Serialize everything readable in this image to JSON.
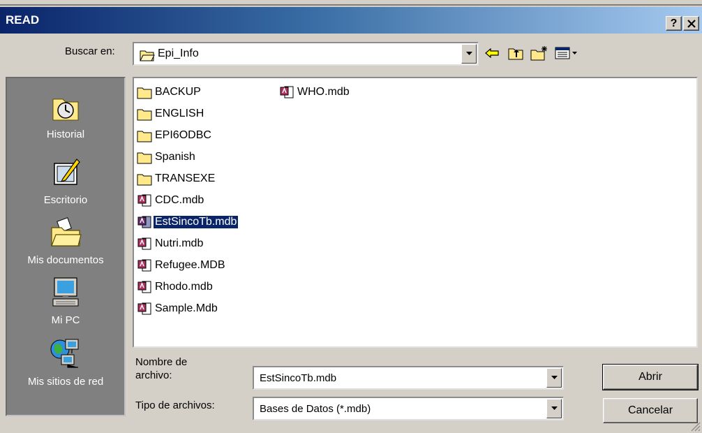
{
  "window": {
    "title": "READ",
    "help_label": "?",
    "close_label": "✕"
  },
  "lookin": {
    "label": "Buscar en:",
    "value": "Epi_Info"
  },
  "toolbar": {
    "back_icon": "back-arrow-icon",
    "up_icon": "up-folder-icon",
    "new_folder_icon": "new-folder-icon",
    "view_icon": "view-menu-icon"
  },
  "places": [
    {
      "label": "Historial",
      "icon": "history-icon"
    },
    {
      "label": "Escritorio",
      "icon": "desktop-icon"
    },
    {
      "label": "Mis documentos",
      "icon": "my-documents-icon"
    },
    {
      "label": "Mi PC",
      "icon": "my-computer-icon"
    },
    {
      "label": "Mis sitios de red",
      "icon": "network-places-icon"
    }
  ],
  "files": [
    {
      "name": "BACKUP",
      "type": "folder"
    },
    {
      "name": "ENGLISH",
      "type": "folder"
    },
    {
      "name": "EPI6ODBC",
      "type": "folder"
    },
    {
      "name": "Spanish",
      "type": "folder"
    },
    {
      "name": "TRANSEXE",
      "type": "folder"
    },
    {
      "name": "CDC.mdb",
      "type": "mdb"
    },
    {
      "name": "EstSincoTb.mdb",
      "type": "mdb",
      "selected": true
    },
    {
      "name": "Nutri.mdb",
      "type": "mdb"
    },
    {
      "name": "Refugee.MDB",
      "type": "mdb"
    },
    {
      "name": "Rhodo.mdb",
      "type": "mdb"
    },
    {
      "name": "Sample.Mdb",
      "type": "mdb"
    },
    {
      "name": "WHO.mdb",
      "type": "mdb"
    }
  ],
  "filename": {
    "label_line1": "Nombre de",
    "label_line2": "archivo:",
    "value": "EstSincoTb.mdb"
  },
  "filetype": {
    "label": "Tipo de archivos:",
    "value": "Bases de Datos (*.mdb)"
  },
  "buttons": {
    "open": "Abrir",
    "cancel": "Cancelar"
  }
}
